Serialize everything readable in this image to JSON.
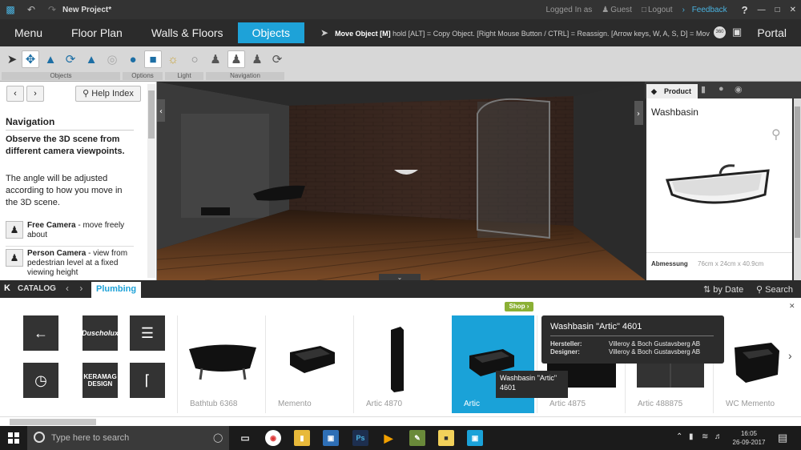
{
  "title_bar": {
    "project_title": "New Project*",
    "logged_in": "Logged In as",
    "user": "Guest",
    "logout": "Logout",
    "feedback": "Feedback",
    "help": "?"
  },
  "nav": {
    "tabs": [
      "Menu",
      "Floor Plan",
      "Walls & Floors",
      "Objects"
    ],
    "active_tab": "Objects",
    "hint_bold": "Move Object [M]",
    "hint_text": " hold [ALT] = Copy Object. [Right Mouse Button / CTRL] = Reassign. [Arrow keys, W, A, S, D] = Mov",
    "portal": "Portal"
  },
  "toolbar": {
    "groups": [
      "Objects",
      "Options",
      "Light",
      "Navigation"
    ]
  },
  "left_panel": {
    "help_index": "Help Index",
    "heading": "Navigation",
    "description": "Observe the 3D scene from different camera viewpoints.",
    "angle_text": "The angle will be adjusted according to how you move in the 3D scene.",
    "free_camera_title": "Free Camera",
    "free_camera_text": " - move freely about",
    "person_camera_title": "Person Camera",
    "person_camera_text": " - view from pedestrian level at a fixed viewing height"
  },
  "right_panel": {
    "tab_product": "Product",
    "product_title": "Washbasin",
    "dimension_label": "Abmessung",
    "dimension_value": "76cm x 24cm x 40.9cm"
  },
  "catalog_bar": {
    "label": "CATALOG",
    "active_tab": "Plumbing",
    "sort": "by Date",
    "search": "Search"
  },
  "catalog": {
    "items": [
      {
        "label": "Bathtub 6368"
      },
      {
        "label": "Memento"
      },
      {
        "label": "Artic 4870"
      },
      {
        "label": "Artic",
        "selected": true
      },
      {
        "label": "Artic 4875"
      },
      {
        "label": "Artic 488875"
      },
      {
        "label": "WC Memento"
      }
    ],
    "brand_buttons": [
      "Duscholux",
      "KERAMAG DESIGN"
    ],
    "shop_badge": "Shop ›",
    "popup": {
      "title": "Washbasin \"Artic\" 4601",
      "manufacturer_label": "Hersteller:",
      "manufacturer_value": "Villeroy & Boch Gustavsberg AB",
      "designer_label": "Designer:",
      "designer_value": "Villeroy & Boch Gustavsberg AB"
    },
    "tooltip_line1": "Washbasin \"Artic\"",
    "tooltip_line2": "4601"
  },
  "taskbar": {
    "search_placeholder": "Type here to search",
    "time": "16:05",
    "date": "26-09-2017"
  },
  "colors": {
    "accent": "#1ea2d8",
    "shop_green": "#8bb035",
    "feedback_blue": "#4ab3e0"
  }
}
